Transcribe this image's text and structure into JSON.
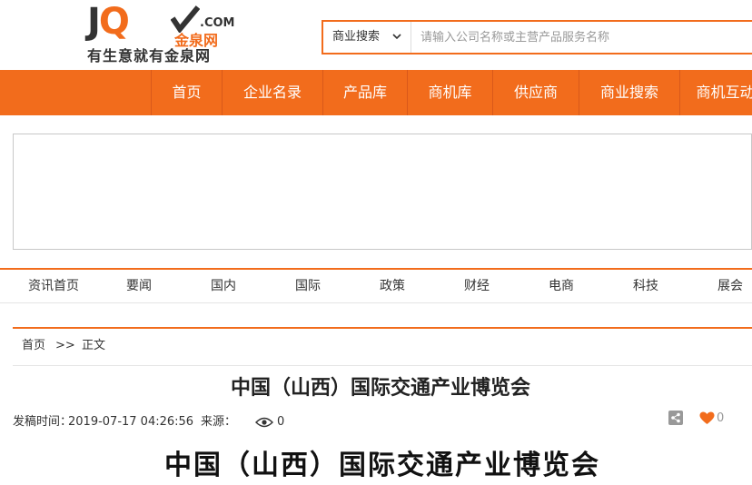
{
  "logo": {
    "letters_j": "J",
    "letters_q": "Q",
    "com": ".COM",
    "cn_name": "金泉网",
    "slogan": "有生意就有金泉网"
  },
  "search": {
    "type_label": "商业搜索",
    "placeholder": "请输入公司名称或主营产品服务名称"
  },
  "main_nav": [
    {
      "label": "首页"
    },
    {
      "label": "企业名录"
    },
    {
      "label": "产品库"
    },
    {
      "label": "商机库"
    },
    {
      "label": "供应商"
    },
    {
      "label": "商业搜索"
    },
    {
      "label": "商机互动"
    }
  ],
  "sub_nav": [
    {
      "label": "资讯首页"
    },
    {
      "label": "要闻"
    },
    {
      "label": "国内"
    },
    {
      "label": "国际"
    },
    {
      "label": "政策"
    },
    {
      "label": "财经"
    },
    {
      "label": "电商"
    },
    {
      "label": "科技"
    },
    {
      "label": "展会"
    }
  ],
  "breadcrumb": {
    "home": "首页",
    "sep": ">>",
    "current": "正文"
  },
  "article": {
    "title": "中国（山西）国际交通产业博览会",
    "published_label": "发稿时间：",
    "published": "2019-07-17 04:26:56",
    "source_label": "来源：",
    "views": "0",
    "likes": "0",
    "body_heading": "中国（山西）国际交通产业博览会"
  },
  "colors": {
    "accent": "#f26c1c",
    "like": "#f26c1c"
  }
}
